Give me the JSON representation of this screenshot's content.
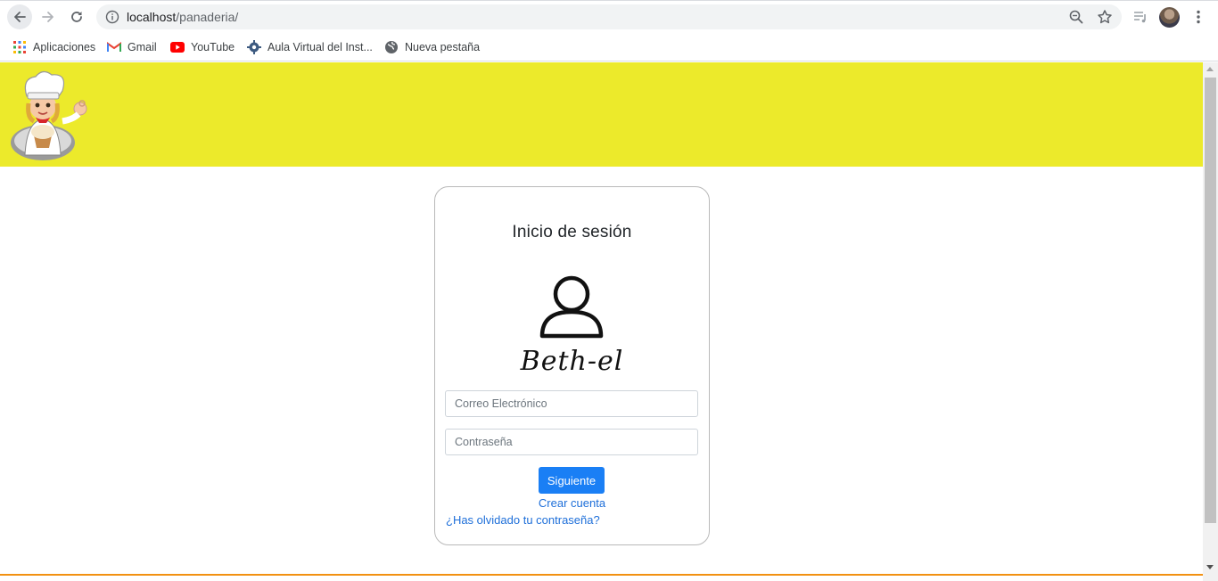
{
  "browser": {
    "url_host": "localhost",
    "url_path": "/panaderia/",
    "icons": {
      "back": "arrow-left-icon",
      "forward": "arrow-right-icon",
      "reload": "reload-icon",
      "site_info": "info-icon",
      "zoom": "zoom-icon",
      "bookmark_star": "star-icon",
      "media": "media-queue-icon",
      "profile": "avatar",
      "menu": "kebab-menu-icon"
    }
  },
  "bookmarks": [
    {
      "label": "Aplicaciones",
      "icon": "apps-grid-icon"
    },
    {
      "label": "Gmail",
      "icon": "gmail-icon"
    },
    {
      "label": "YouTube",
      "icon": "youtube-icon"
    },
    {
      "label": "Aula Virtual del Inst...",
      "icon": "gear-icon"
    },
    {
      "label": "Nueva pestaña",
      "icon": "globe-icon"
    }
  ],
  "header": {
    "logo": "chef-logo",
    "background": "#ecea2b"
  },
  "login": {
    "title": "Inicio de sesión",
    "icon": "user-icon",
    "brand": "Beth-el",
    "email_placeholder": "Correo Electrónico",
    "email_value": "",
    "password_placeholder": "Contraseña",
    "password_value": "",
    "submit_label": "Siguiente",
    "create_account": "Crear cuenta",
    "forgot_password": "¿Has olvidado tu contraseña?"
  },
  "colors": {
    "primary_button": "#1a7ff5",
    "link": "#1e6fd9",
    "footer_line": "#f29111"
  }
}
